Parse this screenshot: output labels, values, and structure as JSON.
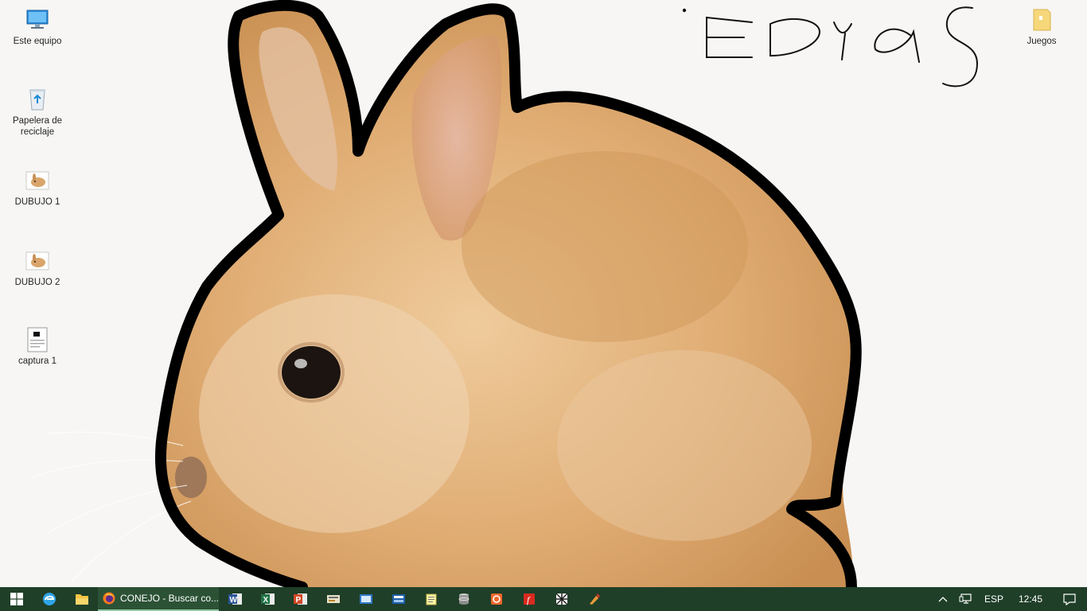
{
  "desktop": {
    "icons": [
      {
        "label": "Este equipo",
        "icon": "computer-icon"
      },
      {
        "label": "Papelera de reciclaje",
        "icon": "recycle-bin-icon"
      },
      {
        "label": "DUBUJO 1",
        "icon": "rabbit-image-icon"
      },
      {
        "label": "DUBUJO 2",
        "icon": "rabbit-image-icon"
      },
      {
        "label": "captura 1",
        "icon": "screenshot-file-icon"
      },
      {
        "label": "Juegos",
        "icon": "folder-icon"
      }
    ],
    "handwriting": "Edyag"
  },
  "taskbar": {
    "active_window": "CONEJO - Buscar co...",
    "apps": [
      "start",
      "edge",
      "file-explorer",
      "firefox",
      "word",
      "excel",
      "powerpoint",
      "app-1",
      "app-2",
      "app-3",
      "notepad",
      "database",
      "app-4",
      "flash",
      "app-5",
      "app-6"
    ],
    "language": "ESP",
    "time": "12:45"
  },
  "colors": {
    "taskbar": "#1f3f28",
    "taskbar_active": "#2c5236",
    "rabbit_fur": "#e3b17a",
    "outline": "#000000"
  }
}
